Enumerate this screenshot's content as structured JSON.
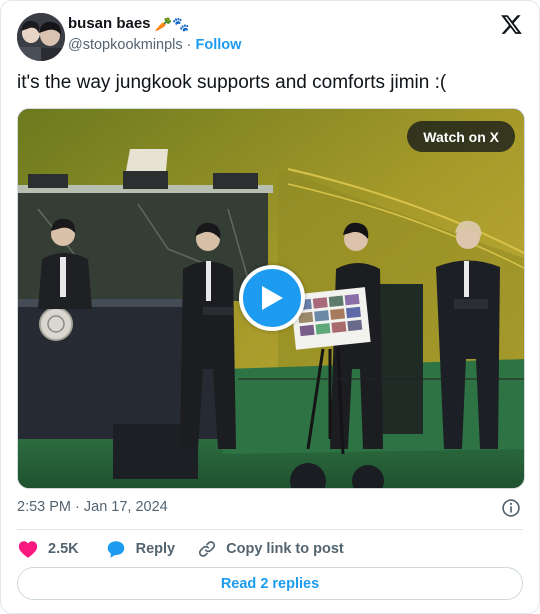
{
  "author": {
    "display_name": "busan baes",
    "emoji": "🥕🐾",
    "handle": "@stopkookminpls",
    "separator": "·",
    "follow_label": "Follow"
  },
  "tweet": {
    "text": "it's the way jungkook supports and comforts jimin :("
  },
  "media": {
    "watch_label": "Watch on X",
    "kind": "video"
  },
  "meta": {
    "timestamp": "2:53 PM · Jan 17, 2024"
  },
  "actions": {
    "like_count": "2.5K",
    "reply_label": "Reply",
    "copy_label": "Copy link to post"
  },
  "footer": {
    "read_replies_label": "Read 2 replies"
  },
  "colors": {
    "accent": "#1d9bf0",
    "like": "#f91880",
    "text": "#0f1419",
    "muted": "#536471"
  },
  "icons": [
    "x-logo-icon",
    "info-icon",
    "heart-icon",
    "reply-bubble-icon",
    "link-icon",
    "play-icon"
  ]
}
